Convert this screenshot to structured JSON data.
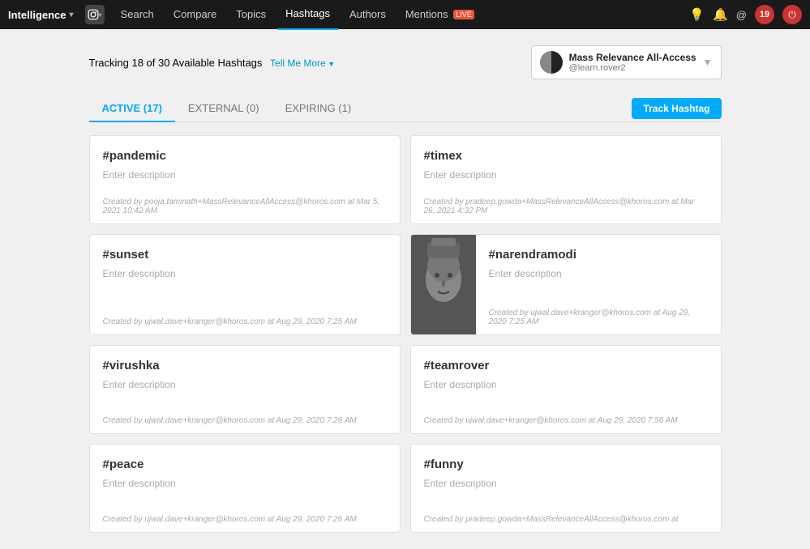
{
  "nav": {
    "brand": "Intelligence",
    "brand_dropdown_icon": "▾",
    "ig_icon": "📷",
    "items": [
      {
        "label": "Search",
        "active": false
      },
      {
        "label": "Compare",
        "active": false
      },
      {
        "label": "Topics",
        "active": false
      },
      {
        "label": "Hashtags",
        "active": true
      },
      {
        "label": "Authors",
        "active": false
      },
      {
        "label": "Mentions",
        "active": false,
        "badge": "LIVE"
      }
    ],
    "icons": {
      "bell": "🔔",
      "notification": "🔔",
      "email": "@",
      "avatar_label": "19",
      "power": "⏻"
    }
  },
  "tracking": {
    "text": "Tracking 18 of 30 Available Hashtags",
    "tell_me_more": "Tell Me More"
  },
  "account": {
    "name": "Mass Relevance All-Access",
    "handle": "@learn.rover2"
  },
  "tabs": [
    {
      "label": "ACTIVE (17)",
      "active": true
    },
    {
      "label": "EXTERNAL (0)",
      "active": false
    },
    {
      "label": "EXPIRING (1)",
      "active": false
    }
  ],
  "track_button": "Track Hashtag",
  "hashtags": [
    {
      "id": "pandemic",
      "name": "#pandemic",
      "description": "Enter description",
      "meta": "Created by pooja.taminath+MassRelevanceAllAccess@khoros.com at Mar 5, 2021 10:42 AM",
      "image": null
    },
    {
      "id": "timex",
      "name": "#timex",
      "description": "Enter description",
      "meta": "Created by pradeep.gowda+MassRelevanceAllAccess@khoros.com at Mar 26, 2021 4:32 PM",
      "image": null
    },
    {
      "id": "sunset",
      "name": "#sunset",
      "description": "Enter description",
      "meta": "Created by ujwal.dave+kranger@khoros.com at Aug 29, 2020 7:25 AM",
      "image": null
    },
    {
      "id": "narendramodi",
      "name": "#narendramodi",
      "description": "Enter description",
      "meta": "Created by ujwal.dave+kranger@khoros.com at Aug 29, 2020 7:25 AM",
      "image": "face_sculpture"
    },
    {
      "id": "virushka",
      "name": "#virushka",
      "description": "Enter description",
      "meta": "Created by ujwal.dave+kranger@khoros.com at Aug 29, 2020 7:26 AM",
      "image": null
    },
    {
      "id": "teamrover",
      "name": "#teamrover",
      "description": "Enter description",
      "meta": "Created by ujwal.dave+kranger@khoros.com at Aug 29, 2020 7:56 AM",
      "image": null
    },
    {
      "id": "peace",
      "name": "#peace",
      "description": "Enter description",
      "meta": "Created by ujwal.dave+kranger@khoros.com at Aug 29, 2020 7:26 AM",
      "image": null
    },
    {
      "id": "funny",
      "name": "#funny",
      "description": "Enter description",
      "meta": "Created by pradeep.gowda+MassRelevanceAllAccess@khoros.com at",
      "image": null
    }
  ]
}
